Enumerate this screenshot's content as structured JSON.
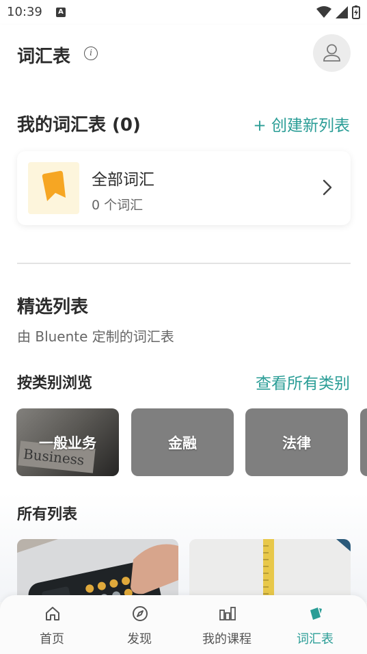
{
  "status_bar": {
    "time": "10:39",
    "notification_icon": "A"
  },
  "header": {
    "title": "词汇表",
    "info_icon": "info-icon",
    "avatar_icon": "user-icon"
  },
  "my_lists": {
    "title": "我的词汇表 (0)",
    "create_label": "+ 创建新列表",
    "all_words_card": {
      "title": "全部词汇",
      "count_label": "0 个词汇"
    }
  },
  "featured": {
    "title": "精选列表",
    "subtitle": "由 Bluente 定制的词汇表",
    "browse_title": "按类别浏览",
    "browse_link": "查看所有类别",
    "categories": [
      {
        "label": "一般业务"
      },
      {
        "label": "金融"
      },
      {
        "label": "法律"
      }
    ]
  },
  "all_lists": {
    "title": "所有列表"
  },
  "bottom_nav": {
    "items": [
      {
        "label": "首页",
        "icon": "home-icon"
      },
      {
        "label": "发现",
        "icon": "compass-icon"
      },
      {
        "label": "我的课程",
        "icon": "courses-icon"
      },
      {
        "label": "词汇表",
        "icon": "vocabulary-cards-icon"
      }
    ],
    "active_index": 3
  },
  "colors": {
    "accent": "#2a9d96",
    "bookmark": "#f6a623",
    "category_tile": "#7f7f7f"
  }
}
